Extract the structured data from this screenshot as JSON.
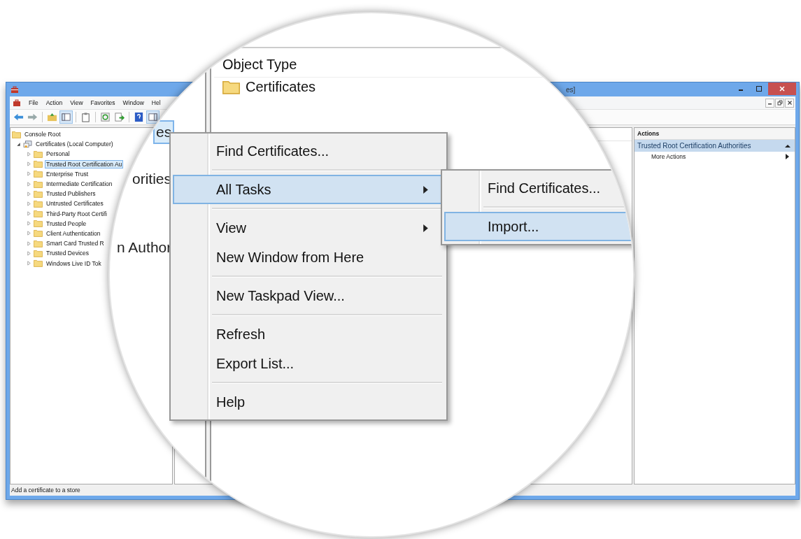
{
  "window": {
    "title": "es]"
  },
  "menu_bar": [
    "File",
    "Action",
    "View",
    "Favorites",
    "Window",
    "Hel"
  ],
  "tree": [
    {
      "label": "Console Root",
      "kind": "folder",
      "children": [
        {
          "label": "Certificates (Local Computer)",
          "kind": "store",
          "expanded": true,
          "selected": false,
          "children": [
            {
              "label": "Personal",
              "kind": "folder",
              "expanded": false,
              "selected": false
            },
            {
              "label": "Trusted Root Certification Au",
              "kind": "folder",
              "expanded": false,
              "selected": true
            },
            {
              "label": "Enterprise Trust",
              "kind": "folder",
              "expanded": false,
              "selected": false
            },
            {
              "label": "Intermediate Certification",
              "kind": "folder",
              "expanded": false,
              "selected": false
            },
            {
              "label": "Trusted Publishers",
              "kind": "folder",
              "expanded": false,
              "selected": false
            },
            {
              "label": "Untrusted Certificates",
              "kind": "folder",
              "expanded": false,
              "selected": false
            },
            {
              "label": "Third-Party Root Certifi",
              "kind": "folder",
              "expanded": false,
              "selected": false
            },
            {
              "label": "Trusted People",
              "kind": "folder",
              "expanded": false,
              "selected": false
            },
            {
              "label": "Client Authentication",
              "kind": "folder",
              "expanded": false,
              "selected": false
            },
            {
              "label": "Smart Card Trusted R",
              "kind": "folder",
              "expanded": false,
              "selected": false
            },
            {
              "label": "Trusted Devices",
              "kind": "folder",
              "expanded": false,
              "selected": false
            },
            {
              "label": "Windows Live ID Tok",
              "kind": "folder",
              "expanded": false,
              "selected": false
            }
          ]
        }
      ]
    }
  ],
  "actions": {
    "title": "Actions",
    "section": {
      "label": "Trusted Root Certification Authorities",
      "expanded": true
    },
    "items": [
      {
        "label": "More Actions"
      }
    ]
  },
  "status_bar": "Add a certificate to a store",
  "magnifier": {
    "tree_fragments": [
      {
        "text": "es",
        "selected": true
      },
      {
        "text": "orities",
        "selected": false
      },
      {
        "text": "n Author",
        "selected": false
      }
    ],
    "list": {
      "column": "Object Type",
      "rows": [
        {
          "label": "Certificates"
        }
      ]
    },
    "context_menu": [
      {
        "kind": "item",
        "label": "Find Certificates...",
        "selected": false,
        "submenu": false
      },
      {
        "kind": "separator"
      },
      {
        "kind": "item",
        "label": "All Tasks",
        "selected": true,
        "submenu": true
      },
      {
        "kind": "separator"
      },
      {
        "kind": "item",
        "label": "View",
        "selected": false,
        "submenu": true
      },
      {
        "kind": "item",
        "label": "New Window from Here",
        "selected": false,
        "submenu": false
      },
      {
        "kind": "separator"
      },
      {
        "kind": "item",
        "label": "New Taskpad View...",
        "selected": false,
        "submenu": false
      },
      {
        "kind": "separator"
      },
      {
        "kind": "item",
        "label": "Refresh",
        "selected": false,
        "submenu": false
      },
      {
        "kind": "item",
        "label": "Export List...",
        "selected": false,
        "submenu": false
      },
      {
        "kind": "separator"
      },
      {
        "kind": "item",
        "label": "Help",
        "selected": false,
        "submenu": false
      }
    ],
    "submenu": [
      {
        "kind": "item",
        "label": "Find Certificates...",
        "selected": false,
        "submenu": false
      },
      {
        "kind": "separator"
      },
      {
        "kind": "item",
        "label": "Import...",
        "selected": true,
        "submenu": false
      }
    ]
  }
}
